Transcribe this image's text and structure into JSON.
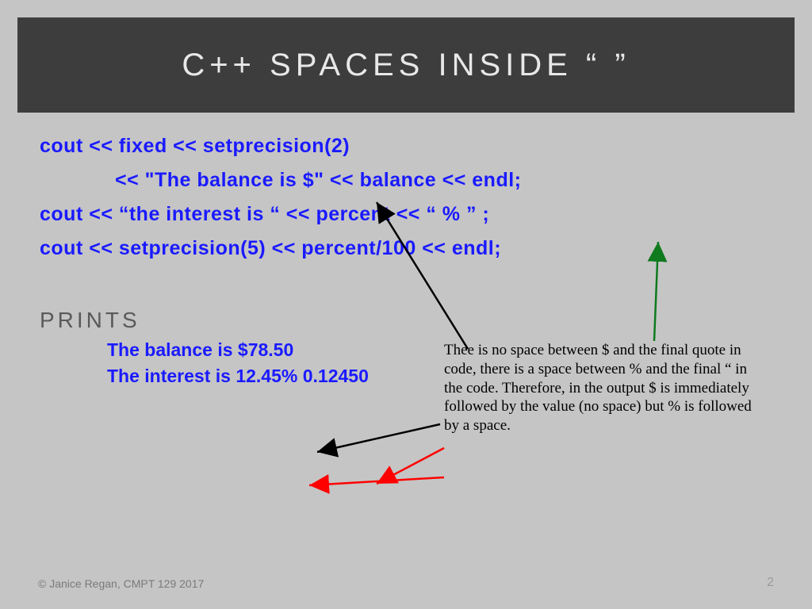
{
  "title": "C++      SPACES INSIDE “ ”",
  "code": {
    "l1": "cout << fixed << setprecision(2)",
    "l2": "<< \"The balance is $\" << balance << endl;",
    "l3": "cout << “the interest is  “ << percent << “ %   ” ;",
    "l4": "cout << setprecision(5) << percent/100 << endl;"
  },
  "prints_label": "PRINTS",
  "output": {
    "o1": "The balance  is $78.50",
    "o2": "The interest is 12.45%   0.12450"
  },
  "explanation": "Thee is no space between $ and the final quote in code, there is a space between % and the final “ in the code.  Therefore, in the output $ is immediately followed by the value (no space) but % is followed by a space.",
  "copyright": "© Janice Regan, CMPT 129 2017",
  "page_number": "2"
}
